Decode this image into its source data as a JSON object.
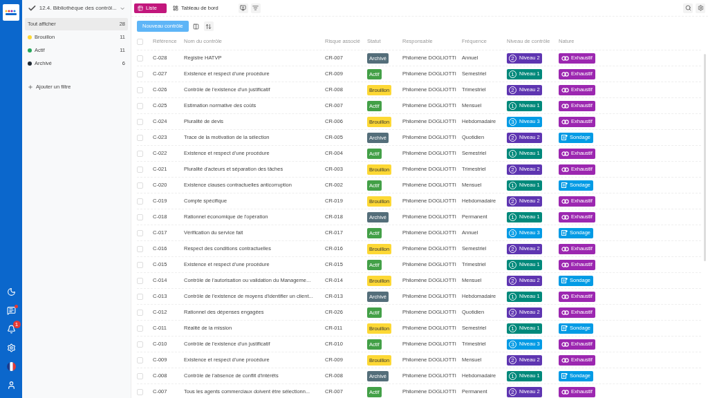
{
  "header": {
    "title": "12.4. Bibliothèque des contrôl...",
    "tabs": [
      {
        "label": "Liste",
        "selected": true
      },
      {
        "label": "Tableau de bord",
        "selected": false
      }
    ]
  },
  "rail": {
    "notification_count": "1",
    "messages_unread": true
  },
  "filters": {
    "items": [
      {
        "label": "Tout afficher",
        "count": "28",
        "selected": true
      },
      {
        "label": "Brouillon",
        "count": "11",
        "selected": false,
        "color": "#fdd835"
      },
      {
        "label": "Actif",
        "count": "11",
        "selected": false,
        "color": "#26a65b"
      },
      {
        "label": "Archivé",
        "count": "6",
        "selected": false,
        "color": "#1f2933"
      }
    ],
    "add_label": "Ajouter un filtre"
  },
  "toolbar": {
    "new_button": "Nouveau contrôle"
  },
  "table": {
    "all_checked": false,
    "columns": [
      "Référence",
      "Nom du contrôle",
      "Risque associé",
      "Statut",
      "Responsable",
      "Fréquence",
      "Niveau de contrôle",
      "Nature"
    ],
    "rows": [
      {
        "checked": false,
        "ref": "C-028",
        "name": "Registre HATVP",
        "risk": "CR-007",
        "status": {
          "label": "Archivé",
          "color": "#546e7a"
        },
        "owner": "Philomène DOGLIOTTI",
        "freq": "Annuel",
        "level": {
          "digit": "2",
          "label": "Niveau 2",
          "color": "#5e35b1"
        },
        "nature": {
          "kind": "exhaustif",
          "label": "Exhaustif",
          "color": "#9c27b0"
        }
      },
      {
        "checked": false,
        "ref": "C-027",
        "name": "Existence et respect d'une procédure",
        "risk": "CR-009",
        "status": {
          "label": "Actif",
          "color": "#43a047"
        },
        "owner": "Philomène DOGLIOTTI",
        "freq": "Semestriel",
        "level": {
          "digit": "1",
          "label": "Niveau 1",
          "color": "#00897b"
        },
        "nature": {
          "kind": "exhaustif",
          "label": "Exhaustif",
          "color": "#9c27b0"
        }
      },
      {
        "checked": false,
        "ref": "C-026",
        "name": "Contrôle de l'existence d'un justificatif",
        "risk": "CR-008",
        "status": {
          "label": "Brouillon",
          "color": "#fdd835"
        },
        "owner": "Philomène DOGLIOTTI",
        "freq": "Trimestriel",
        "level": {
          "digit": "2",
          "label": "Niveau 2",
          "color": "#5e35b1"
        },
        "nature": {
          "kind": "exhaustif",
          "label": "Exhaustif",
          "color": "#9c27b0"
        }
      },
      {
        "checked": false,
        "ref": "C-025",
        "name": "Estimation normative des coûts",
        "risk": "CR-007",
        "status": {
          "label": "Actif",
          "color": "#43a047"
        },
        "owner": "Philomène DOGLIOTTI",
        "freq": "Mensuel",
        "level": {
          "digit": "1",
          "label": "Niveau 1",
          "color": "#00897b"
        },
        "nature": {
          "kind": "exhaustif",
          "label": "Exhaustif",
          "color": "#9c27b0"
        }
      },
      {
        "checked": false,
        "ref": "C-024",
        "name": "Pluralité de devis",
        "risk": "CR-006",
        "status": {
          "label": "Brouillon",
          "color": "#fdd835"
        },
        "owner": "Philomène DOGLIOTTI",
        "freq": "Hebdomadaire",
        "level": {
          "digit": "3",
          "label": "Niveau 3",
          "color": "#039be5"
        },
        "nature": {
          "kind": "exhaustif",
          "label": "Exhaustif",
          "color": "#9c27b0"
        }
      },
      {
        "checked": false,
        "ref": "C-023",
        "name": "Trace de la motivation de la sélection",
        "risk": "CR-005",
        "status": {
          "label": "Archivé",
          "color": "#546e7a"
        },
        "owner": "Philomène DOGLIOTTI",
        "freq": "Quotidien",
        "level": {
          "digit": "2",
          "label": "Niveau 2",
          "color": "#5e35b1"
        },
        "nature": {
          "kind": "sondage",
          "label": "Sondage",
          "color": "#039be5"
        }
      },
      {
        "checked": false,
        "ref": "C-022",
        "name": "Existence et respect d'une procédure",
        "risk": "CR-004",
        "status": {
          "label": "Actif",
          "color": "#43a047"
        },
        "owner": "Philomène DOGLIOTTI",
        "freq": "Semestriel",
        "level": {
          "digit": "1",
          "label": "Niveau 1",
          "color": "#00897b"
        },
        "nature": {
          "kind": "exhaustif",
          "label": "Exhaustif",
          "color": "#9c27b0"
        }
      },
      {
        "checked": false,
        "ref": "C-021",
        "name": "Pluralité d'acteurs et séparation des tâches",
        "risk": "CR-003",
        "status": {
          "label": "Brouillon",
          "color": "#fdd835"
        },
        "owner": "Philomène DOGLIOTTI",
        "freq": "Trimestriel",
        "level": {
          "digit": "2",
          "label": "Niveau 2",
          "color": "#5e35b1"
        },
        "nature": {
          "kind": "exhaustif",
          "label": "Exhaustif",
          "color": "#9c27b0"
        }
      },
      {
        "checked": false,
        "ref": "C-020",
        "name": "Existence clauses contractuelles anticorruption",
        "risk": "CR-002",
        "status": {
          "label": "Actif",
          "color": "#43a047"
        },
        "owner": "Philomène DOGLIOTTI",
        "freq": "Mensuel",
        "level": {
          "digit": "1",
          "label": "Niveau 1",
          "color": "#00897b"
        },
        "nature": {
          "kind": "sondage",
          "label": "Sondage",
          "color": "#039be5"
        }
      },
      {
        "checked": false,
        "ref": "C-019",
        "name": "Compte spécifique",
        "risk": "CR-019",
        "status": {
          "label": "Brouillon",
          "color": "#fdd835"
        },
        "owner": "Philomène DOGLIOTTI",
        "freq": "Hebdomadaire",
        "level": {
          "digit": "2",
          "label": "Niveau 2",
          "color": "#5e35b1"
        },
        "nature": {
          "kind": "exhaustif",
          "label": "Exhaustif",
          "color": "#9c27b0"
        }
      },
      {
        "checked": false,
        "ref": "C-018",
        "name": "Rationnel économique de l'opération",
        "risk": "CR-018",
        "status": {
          "label": "Archivé",
          "color": "#546e7a"
        },
        "owner": "Philomène DOGLIOTTI",
        "freq": "Permanent",
        "level": {
          "digit": "1",
          "label": "Niveau 1",
          "color": "#00897b"
        },
        "nature": {
          "kind": "exhaustif",
          "label": "Exhaustif",
          "color": "#9c27b0"
        }
      },
      {
        "checked": false,
        "ref": "C-017",
        "name": "Vérification du service fait",
        "risk": "CR-017",
        "status": {
          "label": "Actif",
          "color": "#43a047"
        },
        "owner": "Philomène DOGLIOTTI",
        "freq": "Annuel",
        "level": {
          "digit": "3",
          "label": "Niveau 3",
          "color": "#039be5"
        },
        "nature": {
          "kind": "sondage",
          "label": "Sondage",
          "color": "#039be5"
        }
      },
      {
        "checked": false,
        "ref": "C-016",
        "name": "Respect des conditions contractuelles",
        "risk": "CR-016",
        "status": {
          "label": "Brouillon",
          "color": "#fdd835"
        },
        "owner": "Philomène DOGLIOTTI",
        "freq": "Semestriel",
        "level": {
          "digit": "2",
          "label": "Niveau 2",
          "color": "#5e35b1"
        },
        "nature": {
          "kind": "exhaustif",
          "label": "Exhaustif",
          "color": "#9c27b0"
        }
      },
      {
        "checked": false,
        "ref": "C-015",
        "name": "Existence et respect d'une procédure",
        "risk": "CR-015",
        "status": {
          "label": "Actif",
          "color": "#43a047"
        },
        "owner": "Philomène DOGLIOTTI",
        "freq": "Trimestriel",
        "level": {
          "digit": "1",
          "label": "Niveau 1",
          "color": "#00897b"
        },
        "nature": {
          "kind": "exhaustif",
          "label": "Exhaustif",
          "color": "#9c27b0"
        }
      },
      {
        "checked": false,
        "ref": "C-014",
        "name": "Contrôle de l'autorisation ou validation du Manageme...",
        "risk": "CR-014",
        "status": {
          "label": "Brouillon",
          "color": "#fdd835"
        },
        "owner": "Philomène DOGLIOTTI",
        "freq": "Mensuel",
        "level": {
          "digit": "2",
          "label": "Niveau 2",
          "color": "#5e35b1"
        },
        "nature": {
          "kind": "sondage",
          "label": "Sondage",
          "color": "#039be5"
        }
      },
      {
        "checked": false,
        "ref": "C-013",
        "name": "Contrôle de l'existence de moyens d'identifier un client...",
        "risk": "CR-013",
        "status": {
          "label": "Archivé",
          "color": "#546e7a"
        },
        "owner": "Philomène DOGLIOTTI",
        "freq": "Hebdomadaire",
        "level": {
          "digit": "1",
          "label": "Niveau 1",
          "color": "#00897b"
        },
        "nature": {
          "kind": "exhaustif",
          "label": "Exhaustif",
          "color": "#9c27b0"
        }
      },
      {
        "checked": false,
        "ref": "C-012",
        "name": "Rationnel des dépenses engagées",
        "risk": "CR-026",
        "status": {
          "label": "Actif",
          "color": "#43a047"
        },
        "owner": "Philomène DOGLIOTTI",
        "freq": "Quotidien",
        "level": {
          "digit": "2",
          "label": "Niveau 2",
          "color": "#5e35b1"
        },
        "nature": {
          "kind": "exhaustif",
          "label": "Exhaustif",
          "color": "#9c27b0"
        }
      },
      {
        "checked": false,
        "ref": "C-011",
        "name": "Réalité de la mission",
        "risk": "CR-011",
        "status": {
          "label": "Brouillon",
          "color": "#fdd835"
        },
        "owner": "Philomène DOGLIOTTI",
        "freq": "Semestriel",
        "level": {
          "digit": "1",
          "label": "Niveau 1",
          "color": "#00897b"
        },
        "nature": {
          "kind": "sondage",
          "label": "Sondage",
          "color": "#039be5"
        }
      },
      {
        "checked": false,
        "ref": "C-010",
        "name": "Contrôle de l'existence d'un justificatif",
        "risk": "CR-010",
        "status": {
          "label": "Actif",
          "color": "#43a047"
        },
        "owner": "Philomène DOGLIOTTI",
        "freq": "Trimestriel",
        "level": {
          "digit": "3",
          "label": "Niveau 3",
          "color": "#039be5"
        },
        "nature": {
          "kind": "exhaustif",
          "label": "Exhaustif",
          "color": "#9c27b0"
        }
      },
      {
        "checked": false,
        "ref": "C-009",
        "name": "Existence et respect d'une procédure",
        "risk": "CR-009",
        "status": {
          "label": "Brouillon",
          "color": "#fdd835"
        },
        "owner": "Philomène DOGLIOTTI",
        "freq": "Mensuel",
        "level": {
          "digit": "2",
          "label": "Niveau 2",
          "color": "#5e35b1"
        },
        "nature": {
          "kind": "exhaustif",
          "label": "Exhaustif",
          "color": "#9c27b0"
        }
      },
      {
        "checked": false,
        "ref": "C-008",
        "name": "Contrôle de l'absence de conflit d'intérêts",
        "risk": "CR-008",
        "status": {
          "label": "Archivé",
          "color": "#546e7a"
        },
        "owner": "Philomène DOGLIOTTI",
        "freq": "Hebdomadaire",
        "level": {
          "digit": "1",
          "label": "Niveau 1",
          "color": "#00897b"
        },
        "nature": {
          "kind": "sondage",
          "label": "Sondage",
          "color": "#039be5"
        }
      },
      {
        "checked": false,
        "ref": "C-007",
        "name": "Tous les agents commerciaux doivent être sélectionn...",
        "risk": "CR-007",
        "status": {
          "label": "Actif",
          "color": "#43a047"
        },
        "owner": "Philomène DOGLIOTTI",
        "freq": "Permanent",
        "level": {
          "digit": "2",
          "label": "Niveau 2",
          "color": "#5e35b1"
        },
        "nature": {
          "kind": "exhaustif",
          "label": "Exhaustif",
          "color": "#9c27b0"
        }
      }
    ]
  }
}
